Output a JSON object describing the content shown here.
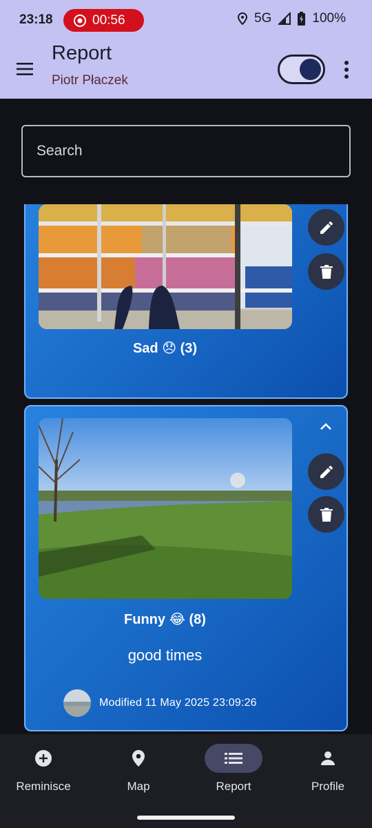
{
  "status_bar": {
    "time": "23:18",
    "recording": "00:56",
    "network": "5G",
    "battery": "100%"
  },
  "app_bar": {
    "title": "Report",
    "subtitle": "Piotr Płaczek",
    "theme_toggle_on": true
  },
  "search": {
    "placeholder": "Search"
  },
  "entries": [
    {
      "caption": "Sad 😞 (3)",
      "photo": "supermarket-fridge-photo"
    },
    {
      "caption": "Funny 😂 (8)",
      "note": "good times",
      "modified": "Modified 11 May 2025 23:09:26",
      "photo": "field-lake-photo"
    }
  ],
  "bottom_nav": {
    "items": [
      {
        "label": "Reminisce",
        "icon": "add-circle-icon"
      },
      {
        "label": "Map",
        "icon": "map-pin-icon"
      },
      {
        "label": "Report",
        "icon": "list-icon",
        "active": true
      },
      {
        "label": "Profile",
        "icon": "person-icon"
      }
    ]
  },
  "colors": {
    "app_bar": "#c4c2f3",
    "card": "#1a6bc8",
    "background": "#111217",
    "record": "#d3101c"
  }
}
